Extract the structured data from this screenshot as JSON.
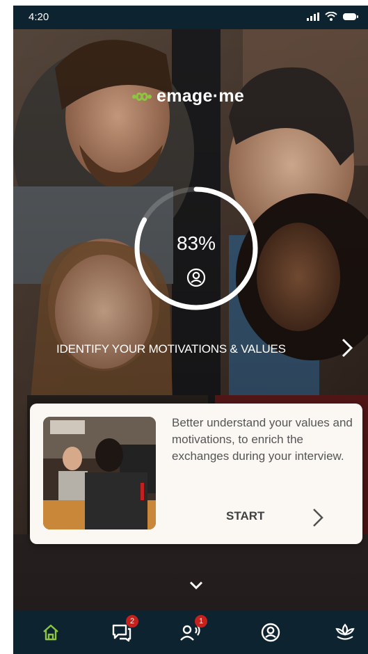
{
  "status_bar": {
    "time": "4:20"
  },
  "brand": {
    "logo_text": "emage·me",
    "accent_color": "#8cc63f"
  },
  "profile_progress": {
    "value_text": "83%",
    "value": 0.83,
    "icon": "user-circle-icon"
  },
  "section": {
    "title": "IDENTIFY YOUR MOTIVATIONS & VALUES"
  },
  "card": {
    "text": "Better understand your values and motivations, to enrich the exchanges during your interview.",
    "start_label": "START"
  },
  "bottom_nav": {
    "items": [
      {
        "icon": "home-icon",
        "active": true
      },
      {
        "icon": "chat-icon",
        "badge": "2"
      },
      {
        "icon": "community-icon",
        "badge": "1"
      },
      {
        "icon": "user-circle-icon"
      },
      {
        "icon": "lotus-icon"
      }
    ]
  },
  "colors": {
    "nav_background": "#0e2330",
    "badge": "#c4221c",
    "card_background": "#fbf8f4"
  }
}
